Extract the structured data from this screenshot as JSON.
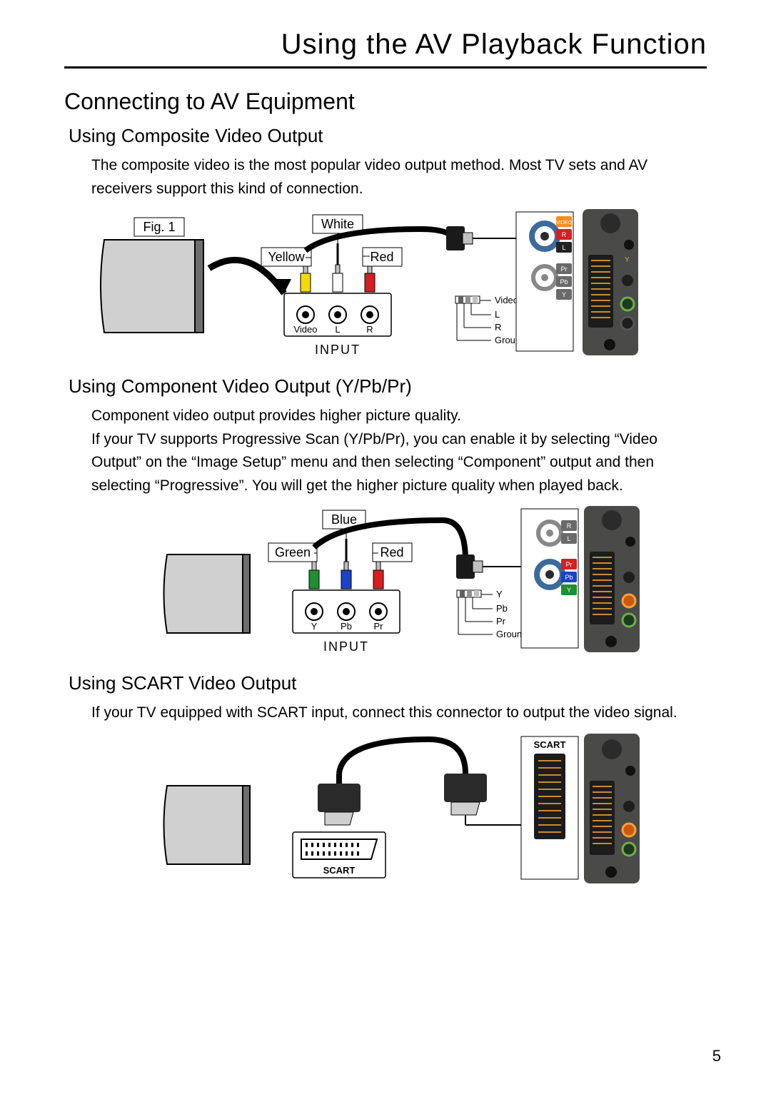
{
  "page": {
    "title": "Using the AV Playback Function",
    "number": "5"
  },
  "section": {
    "title": "Connecting to AV Equipment"
  },
  "sub1": {
    "title": "Using Composite Video Output",
    "paragraph": "The composite video is the most popular video output method. Most TV sets and AV receivers support this kind of connection.",
    "fig_label": "Fig. 1",
    "labels": {
      "white": "White",
      "yellow": "Yellow",
      "red": "Red",
      "video": "Video",
      "l": "L",
      "r": "R",
      "ground": "Ground",
      "input": "INPUT",
      "video_small": "VIDEO",
      "r_small": "R",
      "l_small": "L",
      "pr": "Pr",
      "pb": "Pb",
      "y": "Y"
    }
  },
  "sub2": {
    "title": "Using Component Video Output (Y/Pb/Pr)",
    "paragraph": "Component video output provides higher picture quality.\nIf your TV supports Progressive Scan (Y/Pb/Pr), you can enable it by selecting “Video Output” on the “Image Setup” menu and then selecting “Component” output and then selecting “Progressive”. You will get the higher picture quality when played back.",
    "labels": {
      "blue": "Blue",
      "green": "Green",
      "red": "Red",
      "y": "Y",
      "pb": "Pb",
      "pr": "Pr",
      "ground": "Ground",
      "input": "INPUT"
    }
  },
  "sub3": {
    "title": "Using SCART Video Output",
    "paragraph": "If your TV equipped with SCART input, connect this connector to output the video signal.",
    "labels": {
      "scart": "SCART"
    }
  }
}
